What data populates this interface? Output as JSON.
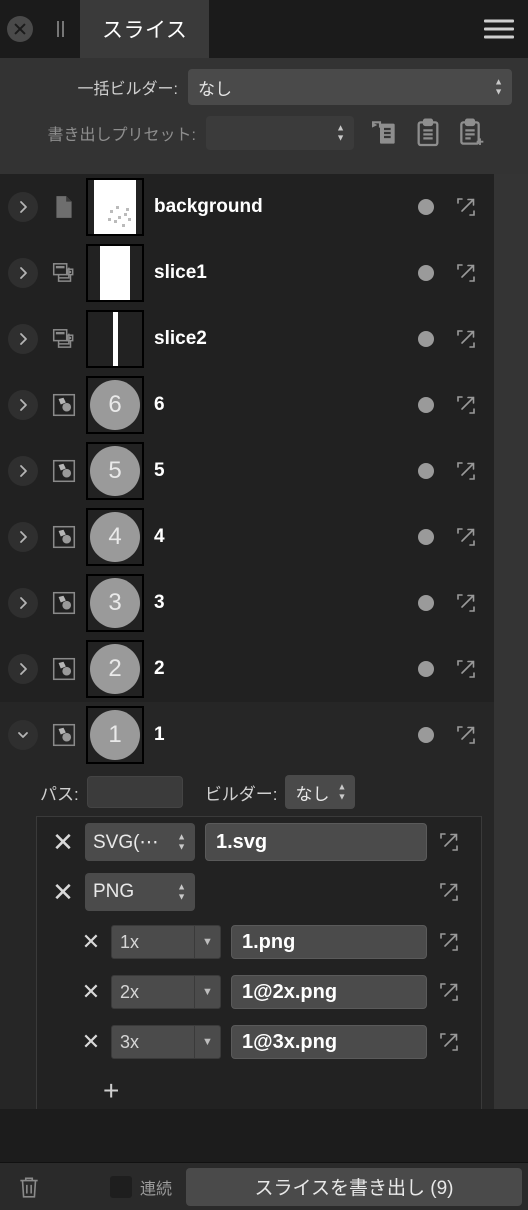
{
  "tabbar": {
    "close_icon": "close-circle-icon",
    "pause_icon": "pause-icon",
    "tab_label": "スライス",
    "menu_icon": "hamburger-icon"
  },
  "options": {
    "batch_builder_label": "一括ビルダー:",
    "batch_builder_value": "なし",
    "export_preset_label": "書き出しプリセット:",
    "export_preset_value": "",
    "preset_icons": [
      "apply-preset-icon",
      "copy-preset-icon",
      "add-preset-icon"
    ]
  },
  "layers": [
    {
      "name": "background",
      "type_icon": "page-icon",
      "thumb": "page",
      "expanded": false,
      "selected": false
    },
    {
      "name": "slice1",
      "type_icon": "slice-icon",
      "thumb": "wide",
      "expanded": false,
      "selected": false
    },
    {
      "name": "slice2",
      "type_icon": "slice-icon",
      "thumb": "narrow",
      "expanded": false,
      "selected": false
    },
    {
      "name": "6",
      "type_icon": "group-icon",
      "thumb": "circle",
      "thumb_text": "6",
      "expanded": false,
      "selected": false
    },
    {
      "name": "5",
      "type_icon": "group-icon",
      "thumb": "circle",
      "thumb_text": "5",
      "expanded": false,
      "selected": false
    },
    {
      "name": "4",
      "type_icon": "group-icon",
      "thumb": "circle",
      "thumb_text": "4",
      "expanded": false,
      "selected": false
    },
    {
      "name": "3",
      "type_icon": "group-icon",
      "thumb": "circle",
      "thumb_text": "3",
      "expanded": false,
      "selected": false
    },
    {
      "name": "2",
      "type_icon": "group-icon",
      "thumb": "circle",
      "thumb_text": "2",
      "expanded": false,
      "selected": false
    },
    {
      "name": "1",
      "type_icon": "group-icon",
      "thumb": "circle",
      "thumb_text": "1",
      "expanded": true,
      "selected": true
    }
  ],
  "detail": {
    "path_label": "パス:",
    "path_value": "",
    "builder_label": "ビルダー:",
    "builder_value": "なし",
    "exports": [
      {
        "remove_label": "✕",
        "format": "SVG(⋯",
        "filename": "1.svg",
        "open_icon": "external-link-icon",
        "scales": []
      },
      {
        "remove_label": "✕",
        "format": "PNG",
        "filename": "",
        "open_icon": "external-link-icon",
        "scales": [
          {
            "remove_label": "✕",
            "scale": "1x",
            "filename": "1.png",
            "open_icon": "external-link-icon"
          },
          {
            "remove_label": "✕",
            "scale": "2x",
            "filename": "1@2x.png",
            "open_icon": "external-link-icon"
          },
          {
            "remove_label": "✕",
            "scale": "3x",
            "filename": "1@3x.png",
            "open_icon": "external-link-icon"
          }
        ]
      }
    ],
    "add_scale_label": "+",
    "add_export_label": "+"
  },
  "bottombar": {
    "trash_icon": "trash-icon",
    "continuous_label": "連続",
    "continuous_checked": false,
    "export_button_label": "スライスを書き出し (9)"
  },
  "colors": {
    "panel_bg": "#212121",
    "options_bg": "#333333",
    "tab_active": "#3a3a3a",
    "field_bg": "#4a4a4a",
    "text": "#d8d8d8",
    "accent_thumb": "#9a9a9a"
  }
}
